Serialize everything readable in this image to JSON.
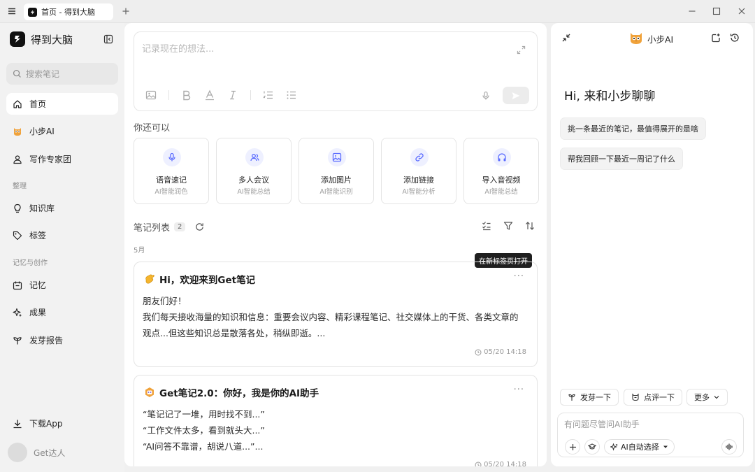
{
  "window": {
    "tab_title": "首页 - 得到大脑"
  },
  "sidebar": {
    "brand": "得到大脑",
    "search_placeholder": "搜索笔记",
    "items": [
      {
        "label": "首页",
        "icon": "home-icon"
      },
      {
        "label": "小步AI",
        "icon": "owl-icon"
      },
      {
        "label": "写作专家团",
        "icon": "user-icon"
      }
    ],
    "section_organize": "整理",
    "organize_items": [
      {
        "label": "知识库",
        "icon": "lightbulb-icon"
      },
      {
        "label": "标签",
        "icon": "tag-icon"
      }
    ],
    "section_memory": "记忆与创作",
    "memory_items": [
      {
        "label": "记忆",
        "icon": "calendar-icon"
      },
      {
        "label": "成果",
        "icon": "sparkle-icon"
      },
      {
        "label": "发芽报告",
        "icon": "sprout-icon"
      }
    ],
    "download_label": "下载App",
    "user_name": "Get达人"
  },
  "editor": {
    "placeholder": "记录现在的想法..."
  },
  "quick_actions": {
    "label": "你还可以",
    "items": [
      {
        "title": "语音速记",
        "subtitle": "AI智能润色",
        "icon": "mic-icon"
      },
      {
        "title": "多人会议",
        "subtitle": "AI智能总结",
        "icon": "people-icon"
      },
      {
        "title": "添加图片",
        "subtitle": "AI智能识别",
        "icon": "image-icon"
      },
      {
        "title": "添加链接",
        "subtitle": "AI智能分析",
        "icon": "link-icon"
      },
      {
        "title": "导入音视频",
        "subtitle": "AI智能总结",
        "icon": "headphones-icon"
      }
    ]
  },
  "notes": {
    "title": "笔记列表",
    "count": "2",
    "month": "5月",
    "tooltip": "在新标签页打开",
    "items": [
      {
        "title": "Hi，欢迎来到Get笔记",
        "lines": [
          "朋友们好！",
          "我们每天接收海量的知识和信息：重要会议内容、精彩课程笔记、社交媒体上的干货、各类文章的",
          "观点...但这些知识总是散落各处，稍纵即逝。..."
        ],
        "time": "05/20 14:18"
      },
      {
        "title": "Get笔记2.0：你好，我是你的AI助手",
        "lines": [
          "“笔记记了一堆，用时找不到...”",
          "“工作文件太多，看到就头大...”",
          "“AI问答不靠谱，胡说八道...”..."
        ],
        "time": "05/20 14:18"
      }
    ]
  },
  "ai": {
    "name": "小步AI",
    "greeting": "Hi, 来和小步聊聊",
    "suggestions": [
      "挑一条最近的笔记，最值得展开的是啥",
      "帮我回顾一下最近一周记了什么"
    ],
    "chips": [
      "发芽一下",
      "点评一下",
      "更多"
    ],
    "input_placeholder": "有问题尽管问AI助手",
    "model_label": "AI自动选择"
  },
  "colors": {
    "accent": "#5b6cff",
    "accent_bg": "#eef0ff",
    "owl": "#f0a23a"
  }
}
